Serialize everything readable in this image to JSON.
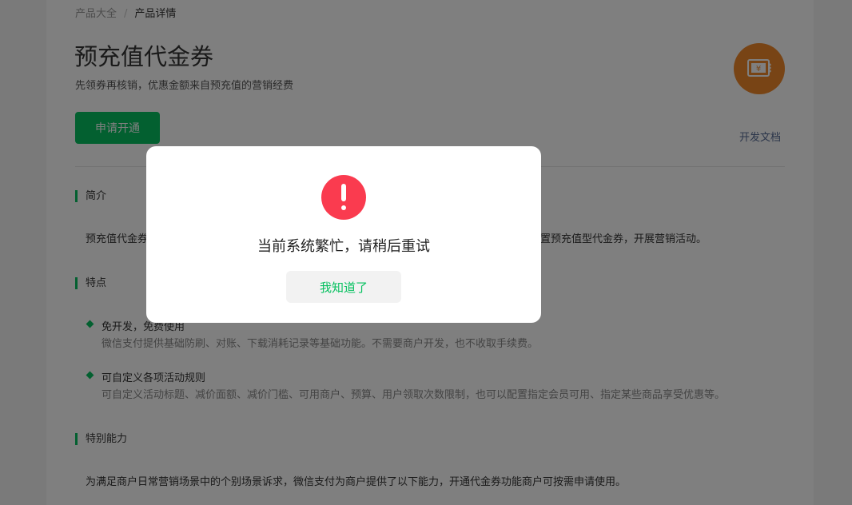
{
  "breadcrumb": {
    "parent": "产品大全",
    "separator": "/",
    "current": "产品详情"
  },
  "product": {
    "title": "预充值代金券",
    "subtitle": "先领券再核销，优惠金额来自预充值的营销经费",
    "icon": "ticket-yen-icon",
    "apply_label": "申请开通",
    "doc_link": "开发文档"
  },
  "sections": {
    "intro": {
      "title": "简介",
      "text_left": "预充值代金券",
      "text_right": "置预充值型代金券，开展营销活动。"
    },
    "features": {
      "title": "特点",
      "items": [
        {
          "title": "免开发，免费使用",
          "desc": "微信支付提供基础防刷、对账、下载消耗记录等基础功能。不需要商户开发，也不收取手续费。"
        },
        {
          "title": "可自定义各项活动规则",
          "desc": "可自定义活动标题、减价面额、减价门槛、可用商户、预算、用户领取次数限制，也可以配置指定会员可用、指定某些商品享受优惠等。"
        }
      ]
    },
    "capabilities": {
      "title": "特别能力",
      "text": "为满足商户日常营销场景中的个别场景诉求，微信支付为商户提供了以下能力，开通代金券功能商户可按需申请使用。"
    }
  },
  "dialog": {
    "icon": "warning-icon",
    "message": "当前系统繁忙，请稍后重试",
    "ok_label": "我知道了"
  },
  "colors": {
    "brand_green": "#07c160",
    "warning_red": "#fa3b4f",
    "icon_orange": "#f0882a",
    "link_blue": "#576b95"
  }
}
